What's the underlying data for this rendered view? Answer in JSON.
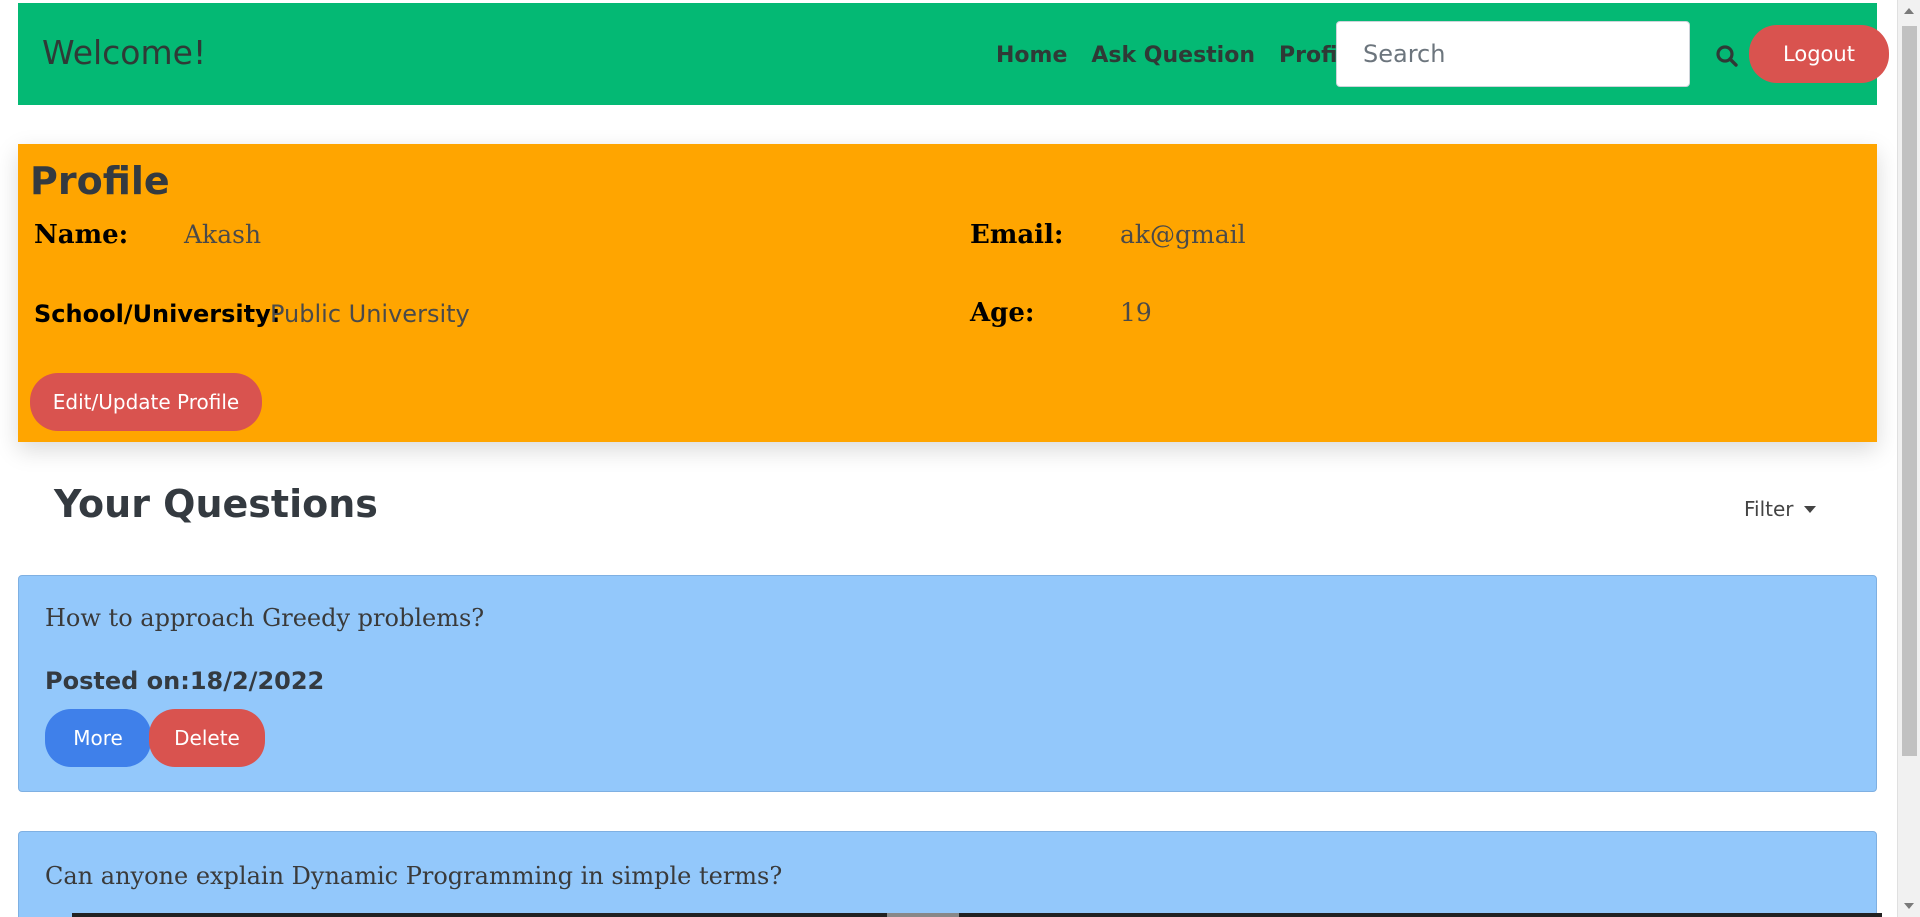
{
  "navbar": {
    "brand": "Welcome!",
    "links": [
      "Home",
      "Ask Question",
      "Profile"
    ],
    "search_placeholder": "Search",
    "search_icon": "search-icon",
    "logout_label": "Logout",
    "bg_color": "#04b974"
  },
  "profile": {
    "title": "Profile",
    "name_label": "Name:",
    "name_value": "Akash",
    "email_label": "Email:",
    "email_value": "ak@gmail",
    "school_label": "School/University:",
    "school_value": "Public University",
    "age_label": "Age:",
    "age_value": "19",
    "edit_label": "Edit/Update Profile",
    "bg_color": "#ffa500"
  },
  "questions": {
    "title": "Your Questions",
    "filter_label": "Filter",
    "items": [
      {
        "title": "How to approach Greedy problems?",
        "posted": "Posted on:18/2/2022",
        "more_label": "More",
        "delete_label": "Delete"
      },
      {
        "title": "Can anyone explain Dynamic Programming in simple terms?"
      }
    ],
    "card_color": "#93c8fb"
  }
}
